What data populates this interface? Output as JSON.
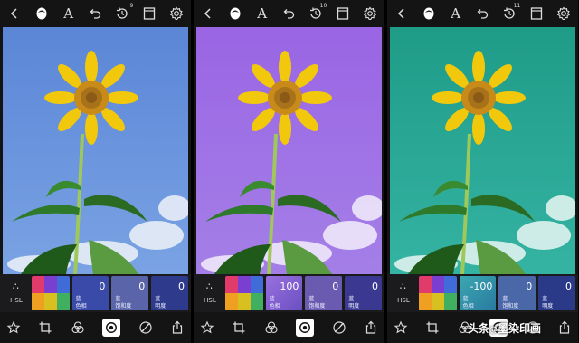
{
  "icons": {
    "back": "chevron-left-icon",
    "mask": "mask-icon",
    "text": "A",
    "undo": "undo-icon",
    "history": "history-icon",
    "compare": "compare-icon",
    "settings": "gear-icon",
    "favorite": "star-icon",
    "crop": "crop-icon",
    "effects": "circles-icon",
    "adjust": "aperture-icon",
    "curves": "curves-icon",
    "share": "share-icon"
  },
  "history_badges": [
    "9",
    "10",
    "11"
  ],
  "hsl_label": "HSL",
  "card_labels": {
    "hue": "色相",
    "saturation": "饱和度",
    "lightness": "明度",
    "channel": "蓝"
  },
  "screens": [
    {
      "bg_top": "#5b86d6",
      "bg_bottom": "#7aa3e4",
      "values": {
        "hue": "0",
        "saturation": "0",
        "lightness": "0"
      }
    },
    {
      "bg_top": "#9a65e4",
      "bg_bottom": "#a47fe7",
      "values": {
        "hue": "100",
        "saturation": "0",
        "lightness": "0"
      }
    },
    {
      "bg_top": "#1f9c88",
      "bg_bottom": "#35b3a3",
      "values": {
        "hue": "-100",
        "saturation": "0",
        "lightness": "0"
      }
    }
  ],
  "watermark": {
    "prefix": "头条",
    "at": "@",
    "name": "墨染印画"
  },
  "colors": {
    "swatch": [
      "#e03b6a",
      "#7a3fd0",
      "#3f6cd8",
      "#f0a020",
      "#d8c020",
      "#40b060"
    ],
    "card": "#3c4ca0",
    "card_light": "#5a66b8"
  }
}
